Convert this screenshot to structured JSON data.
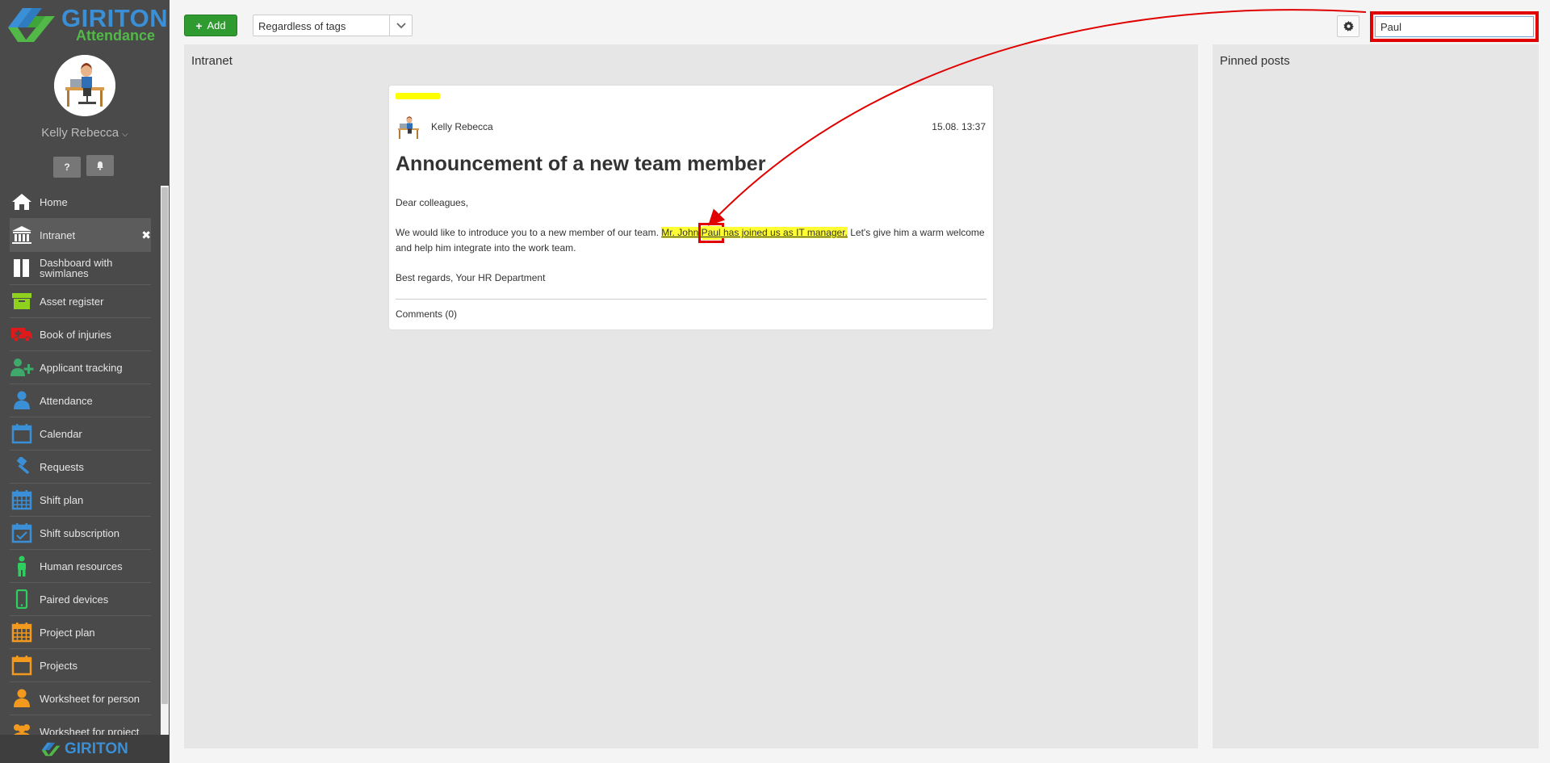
{
  "brand": {
    "logo_title": "GIRITON",
    "logo_subtitle": "Attendance",
    "bottom_logo": "GIRITON",
    "primary_color": "#3a8fd6",
    "secondary_color": "#52b848"
  },
  "user": {
    "name": "Kelly Rebecca"
  },
  "sidebar": {
    "help_icon": "question-icon",
    "notifications_icon": "bell-icon",
    "items": [
      {
        "label": "Home",
        "icon": "home-icon",
        "color": "#ffffff"
      },
      {
        "label": "Intranet",
        "icon": "building-icon",
        "color": "#ffffff",
        "active": true
      },
      {
        "label": "Dashboard with swimlanes",
        "icon": "columns-icon",
        "color": "#ffffff"
      },
      {
        "label": "Asset register",
        "icon": "archive-icon",
        "color": "#8ed11f"
      },
      {
        "label": "Book of injuries",
        "icon": "ambulance-icon",
        "color": "#e01a1a"
      },
      {
        "label": "Applicant tracking",
        "icon": "user-plus-icon",
        "color": "#3fa86b"
      },
      {
        "label": "Attendance",
        "icon": "user-icon",
        "color": "#3a8fd6"
      },
      {
        "label": "Calendar",
        "icon": "calendar-icon",
        "color": "#3a8fd6"
      },
      {
        "label": "Requests",
        "icon": "gavel-icon",
        "color": "#3a8fd6"
      },
      {
        "label": "Shift plan",
        "icon": "calendar-grid-icon",
        "color": "#3a8fd6"
      },
      {
        "label": "Shift subscription",
        "icon": "calendar-check-icon",
        "color": "#3a8fd6"
      },
      {
        "label": "Human resources",
        "icon": "person-icon",
        "color": "#2fcf5f"
      },
      {
        "label": "Paired devices",
        "icon": "mobile-icon",
        "color": "#2fcf5f"
      },
      {
        "label": "Project plan",
        "icon": "calendar-grid-icon",
        "color": "#f39a1e"
      },
      {
        "label": "Projects",
        "icon": "calendar-icon",
        "color": "#f39a1e"
      },
      {
        "label": "Worksheet for person",
        "icon": "user-icon",
        "color": "#f39a1e"
      },
      {
        "label": "Worksheet for project",
        "icon": "users-icon",
        "color": "#f39a1e"
      }
    ]
  },
  "toolbar": {
    "add_label": "Add",
    "tag_filter_value": "Regardless of tags",
    "search_value": "Paul"
  },
  "main": {
    "title": "Intranet",
    "pinned_title": "Pinned posts"
  },
  "post": {
    "author": "Kelly Rebecca",
    "date": "15.08. 13:37",
    "title": "Announcement of a new team member",
    "greeting": "Dear colleagues,",
    "body_before": "We would like to introduce you to a new member of our team. ",
    "highlight_before": "Mr. John ",
    "highlight_match": "Paul",
    "highlight_after": " has joined us as IT manager.",
    "body_after": " Let's give him a warm welcome and help him integrate into the work team.",
    "closing": "Best regards, Your HR Department",
    "comments": "Comments (0)"
  }
}
